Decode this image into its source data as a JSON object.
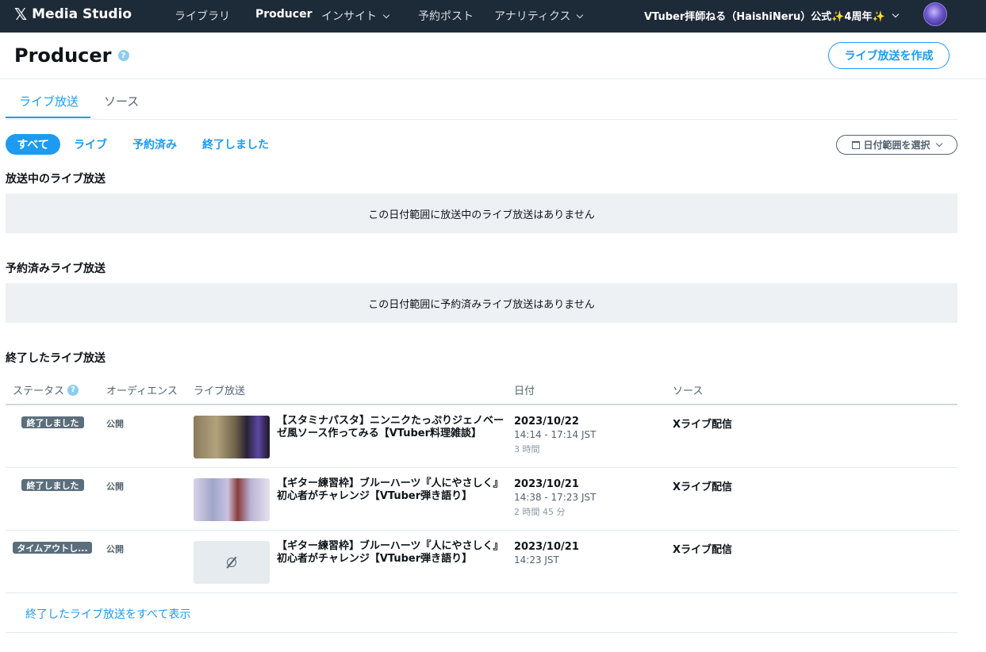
{
  "app": {
    "brand": "Media Studio"
  },
  "nav": {
    "library": "ライブラリ",
    "producer": "Producer",
    "insights": "インサイト",
    "scheduled_posts": "予約ポスト",
    "analytics": "アナリティクス",
    "account": "VTuber拝師ねる（HaishiNeru）公式✨4周年✨"
  },
  "header": {
    "title": "Producer",
    "create_button": "ライブ放送を作成"
  },
  "tabs": {
    "broadcasts": "ライブ放送",
    "sources": "ソース"
  },
  "filters": {
    "all": "すべて",
    "live": "ライブ",
    "scheduled": "予約済み",
    "ended": "終了しました",
    "date_range": "日付範囲を選択"
  },
  "sections": {
    "live": {
      "title": "放送中のライブ放送",
      "empty": "この日付範囲に放送中のライブ放送はありません"
    },
    "scheduled": {
      "title": "予約済みライブ放送",
      "empty": "この日付範囲に予約済みライブ放送はありません"
    },
    "ended": {
      "title": "終了したライブ放送"
    }
  },
  "table": {
    "headers": {
      "status": "ステータス",
      "audience": "オーディエンス",
      "broadcast": "ライブ放送",
      "date": "日付",
      "source": "ソース"
    },
    "rows": [
      {
        "status": "終了しました",
        "audience": "公開",
        "title": "【スタミナパスタ】ニンニクたっぷりジェノベーゼ風ソース作ってみる【VTuber料理雑談】",
        "date": "2023/10/22",
        "time": "14:14 - 17:14 JST",
        "duration": "3 時間",
        "source": "Xライブ配信"
      },
      {
        "status": "終了しました",
        "audience": "公開",
        "title": "【ギター練習枠】ブルーハーツ『人にやさしく』初心者がチャレンジ【VTuber弾き語り】",
        "date": "2023/10/21",
        "time": "14:38 - 17:23 JST",
        "duration": "2 時間 45 分",
        "source": "Xライブ配信"
      },
      {
        "status": "タイムアウトし...",
        "audience": "公開",
        "title": "【ギター練習枠】ブルーハーツ『人にやさしく』初心者がチャレンジ【VTuber弾き語り】",
        "date": "2023/10/21",
        "time": "14:23 JST",
        "duration": "",
        "source": "Xライブ配信"
      }
    ]
  },
  "footer": {
    "show_all": "終了したライブ放送をすべて表示"
  }
}
